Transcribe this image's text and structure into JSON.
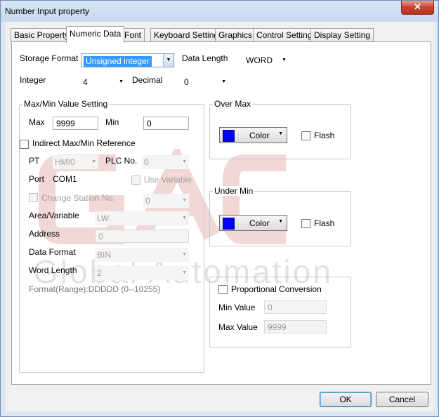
{
  "window": {
    "title": "Number Input property",
    "close_label": "✕"
  },
  "tabs": [
    {
      "label": "Basic Property"
    },
    {
      "label": "Numeric Data"
    },
    {
      "label": "Font"
    },
    {
      "label": "Keyboard Setting"
    },
    {
      "label": "Graphics"
    },
    {
      "label": "Control Setting"
    },
    {
      "label": "Display Setting"
    }
  ],
  "storage": {
    "label": "Storage Format",
    "value": "Unsigned integer"
  },
  "data_length": {
    "label": "Data Length",
    "value": "WORD"
  },
  "integer": {
    "label": "Integer",
    "value": "4"
  },
  "decimal": {
    "label": "Decimal",
    "value": "0"
  },
  "minmax": {
    "title": "Max/Min Value Setting",
    "max_label": "Max",
    "max_value": "9999",
    "min_label": "Min",
    "min_value": "0",
    "indirect_label": "Indirect Max/Min Reference",
    "pt_label": "PT",
    "pt_value": "HMI0",
    "plc_label": "PLC No.",
    "plc_value": "0",
    "port_label": "Port",
    "port_value": "COM1",
    "use_variable_label": "Use Variable",
    "change_station_label": "Change Station No.",
    "change_station_value": "0",
    "area_label": "Area/Variable",
    "area_value": "LW",
    "address_label": "Address",
    "address_value": "0",
    "format_label": "Data Format",
    "format_value": "BIN",
    "word_length_label": "Word Length",
    "word_length_value": "2",
    "format_range": "Format(Range):DDDDD (0--10255)"
  },
  "over_max": {
    "title": "Over Max",
    "color_label": "Color",
    "flash_label": "Flash"
  },
  "under_min": {
    "title": "Under Min",
    "color_label": "Color",
    "flash_label": "Flash"
  },
  "proportional": {
    "label": "Proportional Conversion",
    "min_label": "Min Value",
    "min_value": "0",
    "max_label": "Max Value",
    "max_value": "9999"
  },
  "buttons": {
    "ok": "OK",
    "cancel": "Cancel"
  },
  "watermark": {
    "logo": "GAC",
    "text": "Global Automation"
  },
  "colors": {
    "swatch": "#0000ff",
    "selection": "#3399ff",
    "watermark": "#e8b7b7"
  }
}
